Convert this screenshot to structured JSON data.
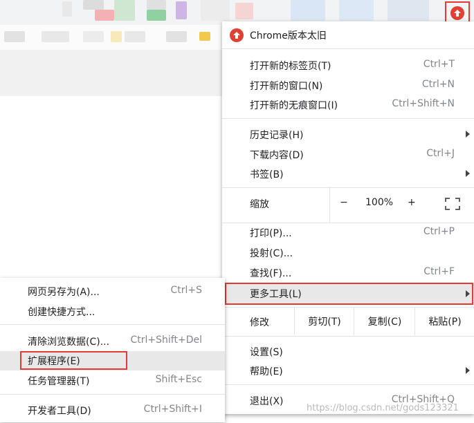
{
  "update_button": {
    "icon": "update-arrow-icon",
    "color": "#e04133"
  },
  "main_menu": {
    "update": "Chrome版本太旧",
    "new_tab": {
      "label": "打开新的标签页(T)",
      "accel": "Ctrl+T"
    },
    "new_window": {
      "label": "打开新的窗口(N)",
      "accel": "Ctrl+N"
    },
    "new_incognito": {
      "label": "打开新的无痕窗口(I)",
      "accel": "Ctrl+Shift+N"
    },
    "history": {
      "label": "历史记录(H)"
    },
    "downloads": {
      "label": "下载内容(D)",
      "accel": "Ctrl+J"
    },
    "bookmarks": {
      "label": "书签(B)"
    },
    "zoom": {
      "label": "缩放",
      "minus": "−",
      "value": "100%",
      "plus": "+"
    },
    "print": {
      "label": "打印(P)...",
      "accel": "Ctrl+P"
    },
    "cast": {
      "label": "投射(C)..."
    },
    "find": {
      "label": "查找(F)...",
      "accel": "Ctrl+F"
    },
    "more_tools": {
      "label": "更多工具(L)"
    },
    "edit": {
      "label": "修改",
      "cut": "剪切(T)",
      "copy": "复制(C)",
      "paste": "粘贴(P)"
    },
    "settings": {
      "label": "设置(S)"
    },
    "help": {
      "label": "帮助(E)"
    },
    "exit": {
      "label": "退出(X)",
      "accel": "Ctrl+Shift+Q"
    }
  },
  "sub_menu": {
    "save_page": {
      "label": "网页另存为(A)...",
      "accel": "Ctrl+S"
    },
    "create_shortcut": {
      "label": "创建快捷方式..."
    },
    "clear_data": {
      "label": "清除浏览数据(C)...",
      "accel": "Ctrl+Shift+Del"
    },
    "extensions": {
      "label": "扩展程序(E)"
    },
    "task_manager": {
      "label": "任务管理器(T)",
      "accel": "Shift+Esc"
    },
    "dev_tools": {
      "label": "开发者工具(D)",
      "accel": "Ctrl+Shift+I"
    }
  },
  "watermark": "https://blog.csdn.net/gods123321",
  "colors": {
    "highlight_border": "#e53935",
    "hover_bg": "#e8e8e8",
    "accel_text": "#80868b"
  }
}
